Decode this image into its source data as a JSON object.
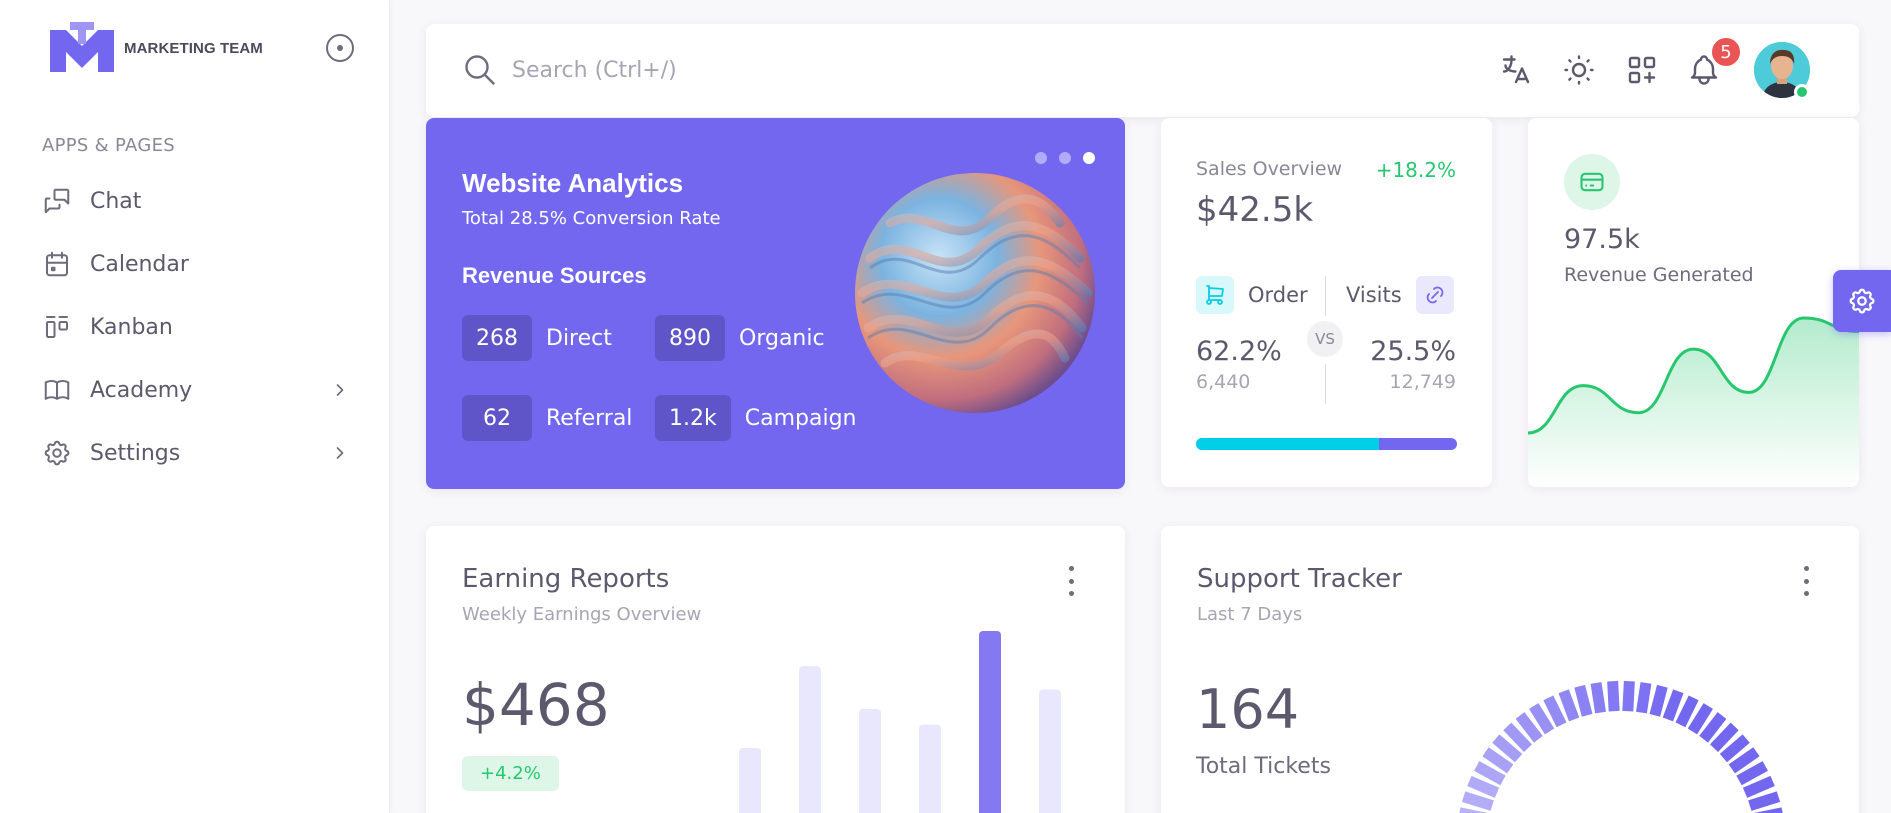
{
  "sidebar": {
    "brand": "MARKETING TEAM",
    "section_header": "APPS & PAGES",
    "items": [
      {
        "label": "Chat",
        "icon": "chat-icon",
        "has_submenu": false
      },
      {
        "label": "Calendar",
        "icon": "calendar-icon",
        "has_submenu": false
      },
      {
        "label": "Kanban",
        "icon": "kanban-icon",
        "has_submenu": false
      },
      {
        "label": "Academy",
        "icon": "book-icon",
        "has_submenu": true
      },
      {
        "label": "Settings",
        "icon": "gear-icon",
        "has_submenu": true
      }
    ]
  },
  "navbar": {
    "search_placeholder": "Search (Ctrl+/)",
    "notification_count": "5",
    "icons": [
      "translate-icon",
      "sun-icon",
      "apps-icon",
      "bell-icon"
    ]
  },
  "analytics": {
    "title": "Website Analytics",
    "subtitle": "Total 28.5% Conversion Rate",
    "revenue_heading": "Revenue Sources",
    "sources": [
      {
        "value": "268",
        "label": "Direct"
      },
      {
        "value": "890",
        "label": "Organic"
      },
      {
        "value": "62",
        "label": "Referral"
      },
      {
        "value": "1.2k",
        "label": "Campaign"
      }
    ]
  },
  "sales": {
    "label": "Sales Overview",
    "delta": "+18.2%",
    "value": "$42.5k",
    "order_label": "Order",
    "visits_label": "Visits",
    "vs": "VS",
    "order_pct": "62.2%",
    "order_count": "6,440",
    "visits_pct": "25.5%",
    "visits_count": "12,749",
    "order_share": 0.7
  },
  "revenue": {
    "value": "97.5k",
    "label": "Revenue Generated"
  },
  "earning": {
    "title": "Earning Reports",
    "subtitle": "Weekly Earnings Overview",
    "value": "$468",
    "delta": "+4.2%"
  },
  "support": {
    "title": "Support Tracker",
    "subtitle": "Last 7 Days",
    "value": "164",
    "label": "Total Tickets"
  },
  "colors": {
    "primary": "#7367f0",
    "success": "#28c76f",
    "info": "#00cfe8",
    "danger": "#ea5455"
  },
  "chart_data": [
    {
      "type": "bar",
      "categories": [
        "",
        "",
        "",
        "",
        "",
        "",
        ""
      ],
      "values": [
        40,
        82,
        60,
        52,
        100,
        70,
        91
      ],
      "highlight_index": 4
    },
    {
      "type": "line",
      "values": [
        10,
        45,
        25,
        72,
        40,
        95,
        85
      ],
      "area": true
    }
  ]
}
